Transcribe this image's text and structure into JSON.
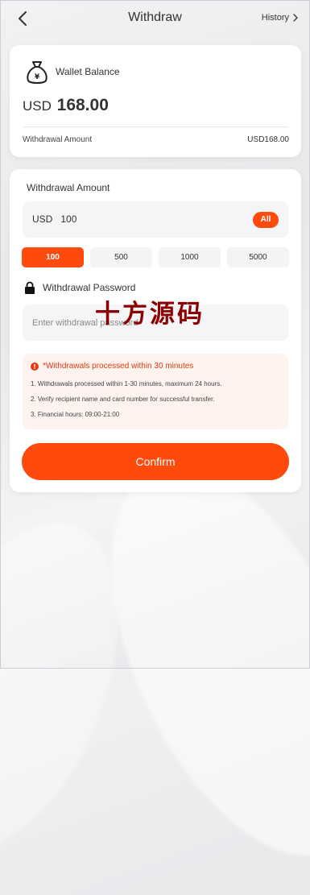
{
  "header": {
    "title": "Withdraw",
    "history_label": "History"
  },
  "wallet": {
    "label": "Wallet Balance",
    "currency": "USD",
    "balance": "168.00",
    "withdrawal_amount_label": "Withdrawal Amount",
    "withdrawal_amount_value": "USD168.00"
  },
  "form": {
    "amount_title": "Withdrawal Amount",
    "amount_prefix": "USD",
    "amount_value": "100",
    "all_label": "All",
    "quick_amounts": [
      "100",
      "500",
      "1000",
      "5000"
    ],
    "selected_quick": "100",
    "password_label": "Withdrawal Password",
    "password_placeholder": "Enter withdrawal password"
  },
  "watermark": "十方源码",
  "notice": {
    "heading": "*Withdrawals processed within 30 minutes",
    "lines": [
      "1. Withdrawals processed within 1-30 minutes, maximum 24 hours.",
      "2. Verify recipient name and card number for successful transfer.",
      "3. Financial hours: 09:00-21:00"
    ]
  },
  "confirm_label": "Confirm",
  "colors": {
    "accent": "#ff4a0e",
    "notice_text": "#e53a0c",
    "notice_bg": "#fff3f0"
  },
  "icons": [
    "back-arrow-icon",
    "chevron-right-icon",
    "money-bag-icon",
    "lock-icon",
    "info-icon"
  ]
}
